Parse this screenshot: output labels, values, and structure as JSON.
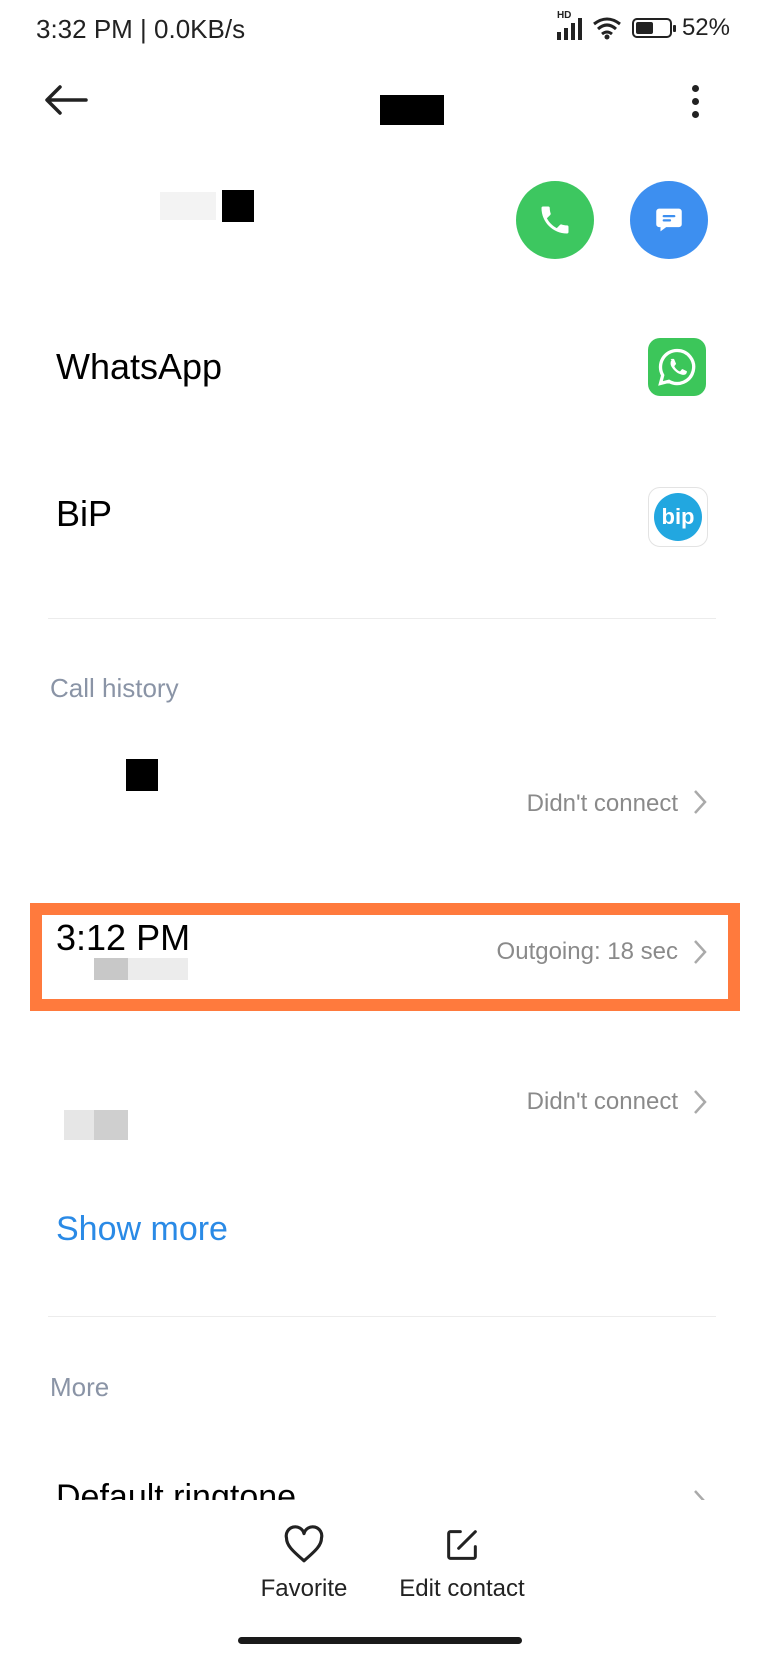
{
  "status_bar": {
    "time": "3:32 PM | 0.0KB/s",
    "network_badge": "HD",
    "battery": "52%"
  },
  "header": {
    "back_icon": "arrow-left-icon",
    "menu_icon": "more-vertical-icon"
  },
  "contact": {
    "call_icon": "phone-icon",
    "message_icon": "message-icon"
  },
  "apps": [
    {
      "label": "WhatsApp",
      "icon": "whatsapp-icon"
    },
    {
      "label": "BiP",
      "icon": "bip-icon",
      "icon_text": "bip"
    }
  ],
  "call_history": {
    "section_title": "Call history",
    "entries": [
      {
        "time": "",
        "status": "Didn't connect"
      },
      {
        "time": "3:12 PM",
        "status": "Outgoing: 18 sec",
        "highlighted": true
      },
      {
        "time": "",
        "status": "Didn't connect"
      }
    ],
    "show_more": "Show more"
  },
  "more": {
    "section_title": "More",
    "items": [
      {
        "label": "Default ringtone"
      }
    ]
  },
  "bottom_actions": [
    {
      "label": "Favorite",
      "icon": "heart-icon"
    },
    {
      "label": "Edit contact",
      "icon": "edit-icon"
    }
  ],
  "colors": {
    "call_green": "#3dc760",
    "message_blue": "#3d8ff0",
    "link_blue": "#2a8ae6",
    "highlight_orange": "#ff7a3d",
    "section_gray": "#8a94a6"
  }
}
